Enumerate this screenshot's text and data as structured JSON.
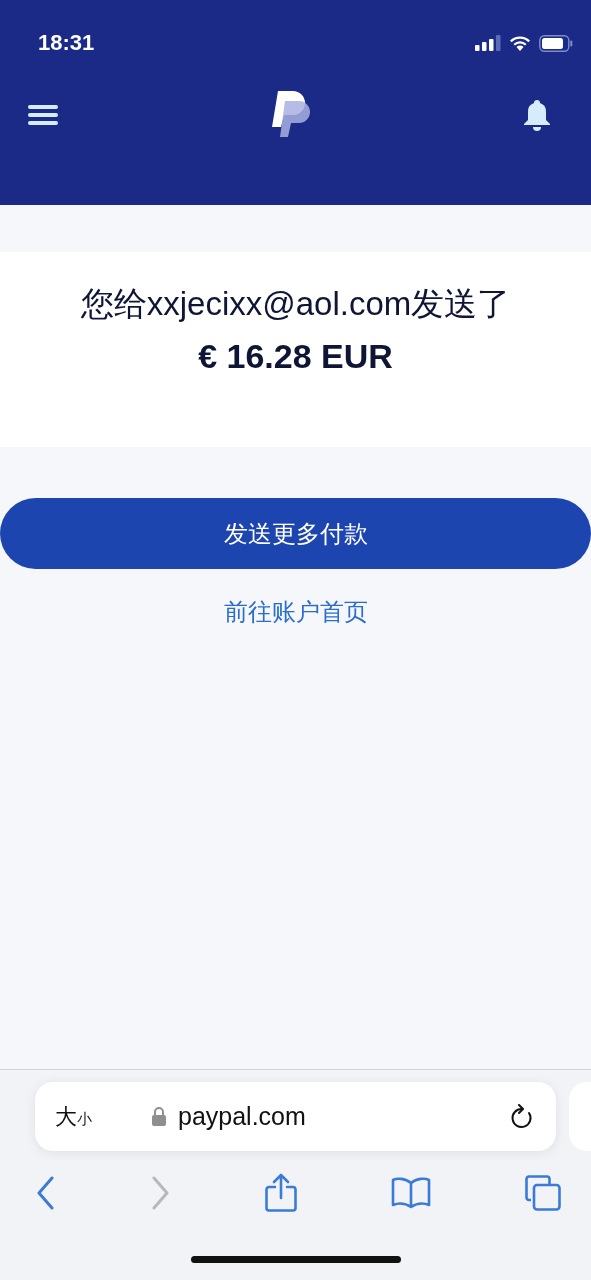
{
  "status_bar": {
    "time": "18:31"
  },
  "confirmation": {
    "message": "您给xxjecixx@aol.com发送了",
    "amount": "€ 16.28 EUR"
  },
  "actions": {
    "primary": "发送更多付款",
    "link": "前往账户首页"
  },
  "browser": {
    "text_size": {
      "large": "大",
      "small": "小"
    },
    "url": "paypal.com",
    "toolbar": [
      {
        "kind": "back",
        "disabled": false
      },
      {
        "kind": "forward",
        "disabled": true
      },
      {
        "kind": "share",
        "disabled": false
      },
      {
        "kind": "bookmarks",
        "disabled": false
      },
      {
        "kind": "tabs",
        "disabled": false
      }
    ]
  }
}
